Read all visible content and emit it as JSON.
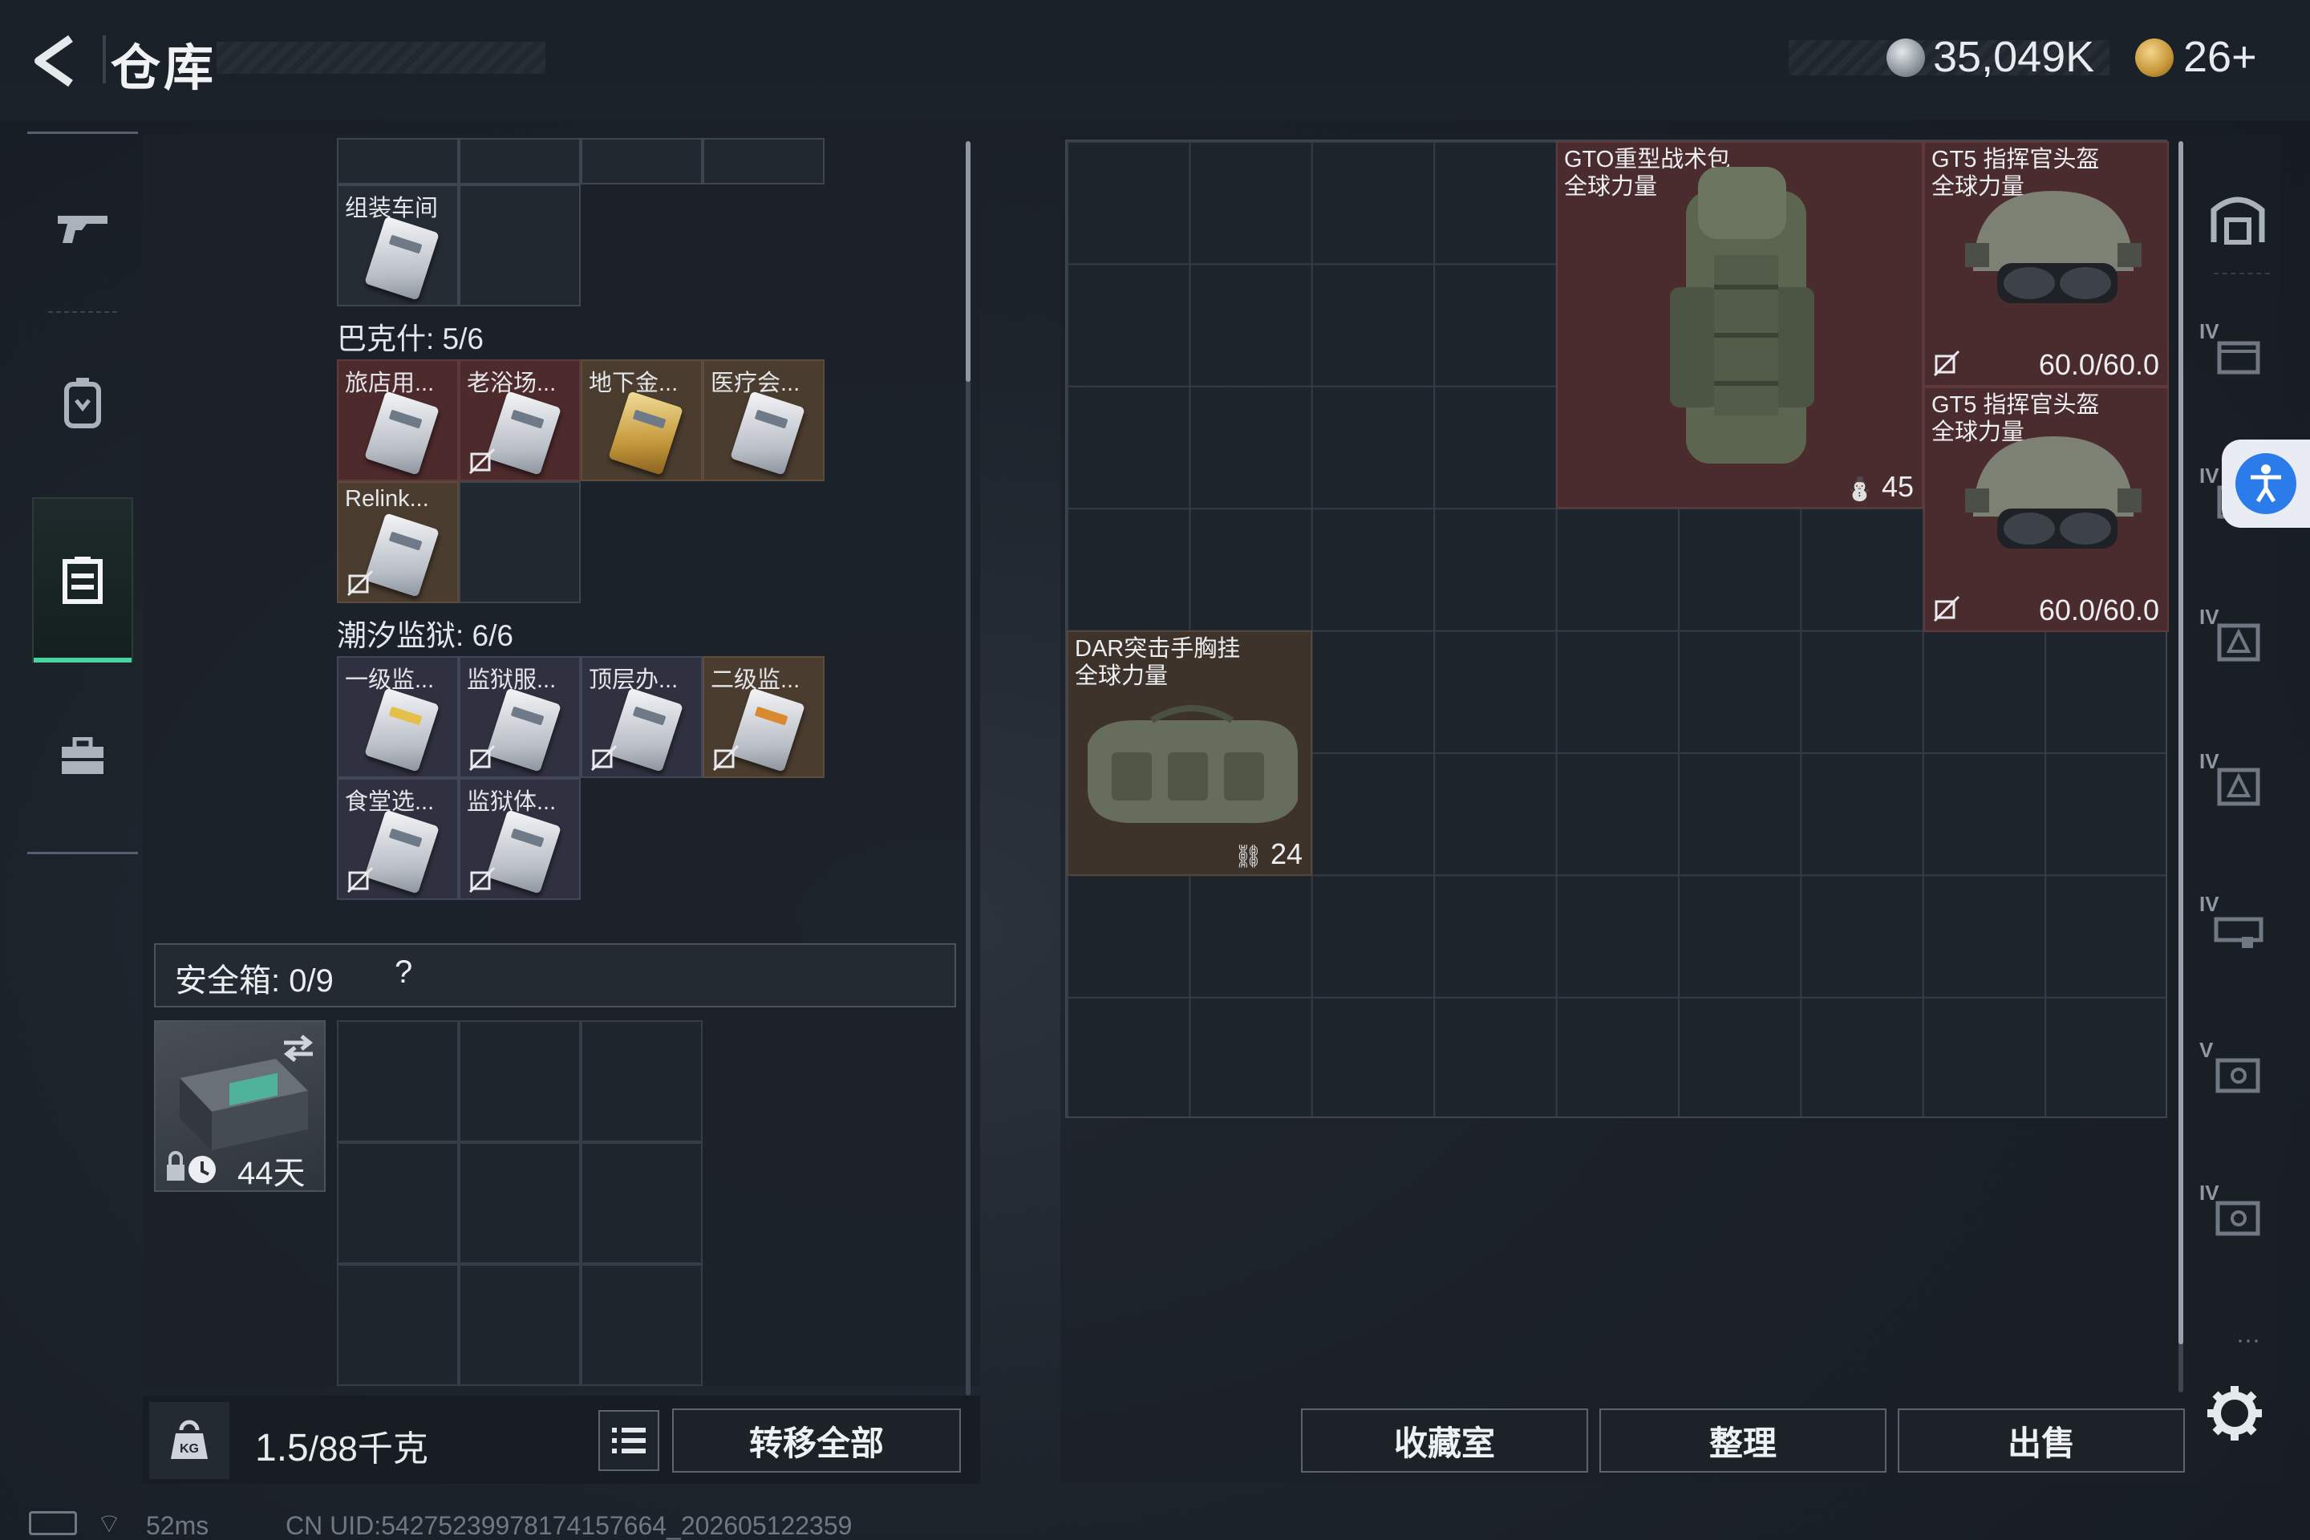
{
  "header": {
    "title": "仓库",
    "currency_silver": "35,049K",
    "currency_gold": "26+"
  },
  "nav": {
    "items": [
      {
        "name": "weapons",
        "icon": "rifle-icon"
      },
      {
        "name": "backpack",
        "icon": "backpack-icon"
      },
      {
        "name": "storage",
        "icon": "locker-icon",
        "active": true
      },
      {
        "name": "toolbox",
        "icon": "briefcase-icon"
      }
    ]
  },
  "keys": {
    "top_item_label": "组装车间",
    "group1": {
      "title": "巴克什: 5/6",
      "items": [
        "旅店用...",
        "老浴场...",
        "地下金...",
        "医疗会...",
        "Relink..."
      ]
    },
    "group2": {
      "title": "潮汐监狱: 6/6",
      "items": [
        "一级监...",
        "监狱服...",
        "顶层办...",
        "二级监...",
        "食堂选...",
        "监狱体..."
      ]
    }
  },
  "safebox": {
    "label": "安全箱:",
    "count": "0/9",
    "help": "?",
    "days": "44天"
  },
  "left_footer": {
    "weight_current": "1.5",
    "weight_rest": "/88千克",
    "transfer_all": "转移全部"
  },
  "stash": {
    "items": [
      {
        "name_line1": "GTO重型战术包",
        "name_line2": "全球力量",
        "value": "45"
      },
      {
        "name_line1": "GT5 指挥官头盔",
        "name_line2": "全球力量",
        "value": "60.0/60.0"
      },
      {
        "name_line1": "GT5 指挥官头盔",
        "name_line2": "全球力量",
        "value": "60.0/60.0"
      },
      {
        "name_line1": "DAR突击手胸挂",
        "name_line2": "全球力量",
        "value": "24"
      }
    ]
  },
  "right_rail": {
    "tiers": [
      "IV",
      "IV",
      "IV",
      "IV",
      "IV",
      "V",
      "IV"
    ],
    "more": "···"
  },
  "right_footer": {
    "collection": "收藏室",
    "organize": "整理",
    "sell": "出售"
  },
  "status": {
    "ping": "52ms",
    "uid": "CN UID:5427523997817415​7664_202605122359"
  },
  "colors": {
    "accent_green": "#49d3a1",
    "rarity_red": "#4d2a2c",
    "rarity_gold": "#4a3c2f",
    "rarity_blue": "#2f3140",
    "access_blue": "#2b7bea"
  }
}
